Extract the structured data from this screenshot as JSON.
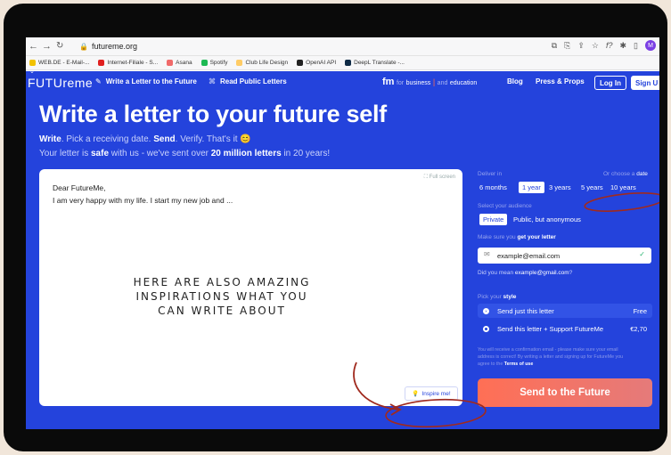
{
  "browser": {
    "url": "futureme.org",
    "avatar_initial": "M",
    "bookmarks": [
      {
        "label": "WEB.DE - E-Mail-...",
        "color": "#f2c200"
      },
      {
        "label": "Internet-Filiale - S...",
        "color": "#e02020"
      },
      {
        "label": "Asana",
        "color": "#f06a6a"
      },
      {
        "label": "Spotify",
        "color": "#1db954"
      },
      {
        "label": "Club Life Design",
        "color": "#ffcc66"
      },
      {
        "label": "OpenAI API",
        "color": "#222222"
      },
      {
        "label": "DeepL Translate -...",
        "color": "#0f2b46"
      }
    ]
  },
  "nav": {
    "logo": "FUTUreme",
    "write_link": "Write a Letter to the Future",
    "read_link": "Read Public Letters",
    "fm_logo": "fm",
    "for_label": "for",
    "business": "business",
    "and_label": "and",
    "education": "education",
    "blog": "Blog",
    "press": "Press & Props",
    "login": "Log In",
    "signup": "Sign U"
  },
  "hero": {
    "title": "Write a letter to your future self",
    "line1": {
      "write": "Write",
      "a": ". Pick a receiving date. ",
      "send": "Send",
      "b": ". Verify. That's it 😊"
    },
    "line2": {
      "a": "Your letter is ",
      "safe": "safe",
      "b": " with us - we've sent over ",
      "million": "20 million letters",
      "c": " in 20 years!"
    }
  },
  "editor": {
    "full_screen": "Full screen",
    "greeting": "Dear FutureMe,",
    "body": "I am very happy with my life. I start my new job and ...",
    "annotation": "HERE ARE ALSO AMAZING INSPIRATIONS WHAT YOU CAN WRITE ABOUT",
    "inspire_button": "Inspire me!"
  },
  "panel": {
    "deliver_label": "Deliver in",
    "choose_date_prefix": "Or choose a",
    "choose_date_link": "date",
    "deliver_options": [
      "6 months",
      "1 year",
      "3 years",
      "5 years",
      "10 years"
    ],
    "deliver_selected": "1 year",
    "audience_label": "Select your audience",
    "audience_private": "Private",
    "audience_public": "Public, but anonymous",
    "email_label_prefix": "Make sure you ",
    "email_label_bold": "get your letter",
    "email_placeholder": "example@email.com",
    "did_you_mean_prefix": "Did you mean ",
    "did_you_mean_email": "example@gmail.com",
    "did_you_mean_suffix": "?",
    "style_label_prefix": "Pick your ",
    "style_label_bold": "style",
    "style_option1": "Send just this letter",
    "style_option1_price": "Free",
    "style_option2": "Send this letter + Support FutureMe",
    "style_option2_price": "€2,70",
    "disclaimer1": "You will receive a confirmation email - please make sure your email",
    "disclaimer2": "address is correct! By writing a letter and signing up for FutureMe you",
    "disclaimer3_prefix": "agree to the ",
    "disclaimer3_link": "Terms of use",
    "send_button": "Send to the Future"
  },
  "colors": {
    "site_blue": "#2443dc",
    "accent_coral": "#ff6f55",
    "annotation_red": "#a02a1e"
  }
}
